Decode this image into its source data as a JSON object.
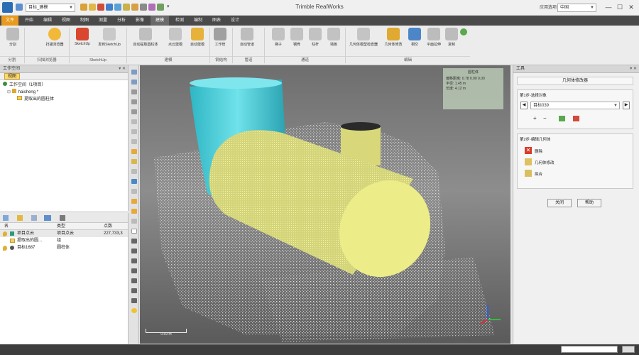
{
  "window": {
    "title": "Trimble RealWorks",
    "coord_combo": "目标_建模",
    "search_label": "应用选项",
    "search_value": "中国",
    "minimize": "—",
    "maximize": "☐",
    "close": "✕"
  },
  "menu": {
    "tabs": [
      "文件",
      "开始",
      "编辑",
      "视图",
      "制图",
      "测量",
      "分析",
      "影像",
      "建模",
      "检测",
      "编制",
      "图表",
      "设计"
    ],
    "active": "建模"
  },
  "ribbon": {
    "buttons": [
      "分割",
      "扫描浏览器",
      "SketchUp",
      "发到SketchUp",
      "自动提取圆柱体",
      "点云建模",
      "自动建模",
      "工作管",
      "自动管道",
      "梯子",
      "钢骨",
      "柱杆",
      "墙板",
      "几何体模型检查器",
      "几何体修改",
      "相交",
      "平面拉伸",
      "复制"
    ],
    "groups": [
      "分割",
      "扫描浏览器",
      "SketchUp",
      "建模",
      "钢结构",
      "管道",
      "通道",
      "编辑"
    ]
  },
  "workspace": {
    "title": "工作空间",
    "tab": "视图",
    "tree": [
      "工作空间（1项目）",
      "haisheng *",
      "提取出的圆柱体"
    ]
  },
  "properties": {
    "columns": [
      "名",
      "类型",
      "点数"
    ],
    "rows": [
      {
        "name": "项目点云",
        "type": "项目点云",
        "points": "227,733,3"
      },
      {
        "name": "提取出的圆...",
        "type": "组",
        "points": ""
      },
      {
        "name": "目标1687",
        "type": "圆柱体",
        "points": ""
      }
    ]
  },
  "viewport": {
    "info": {
      "title": "圆柱体",
      "line1": "偏移距离: 0.78 0.00 0.00",
      "line2": "半径: 1.45 m",
      "line3": "长度: 4.12 m"
    },
    "scale_label": "0.69 m"
  },
  "tools": {
    "title": "工具",
    "subtitle": "几何体修改器",
    "step1": "第1步-选择对象",
    "object_value": "目标039",
    "step2": "第2步-编辑几何体",
    "actions": [
      "删除",
      "几何体修改",
      "拟合"
    ],
    "close_label": "关闭",
    "help_label": "帮助"
  },
  "status": {
    "field": ""
  },
  "colors": {
    "cyan_pipe": "#3fc7d4",
    "tank_yellow": "#ecec88",
    "file_tab": "#e89a1e"
  }
}
